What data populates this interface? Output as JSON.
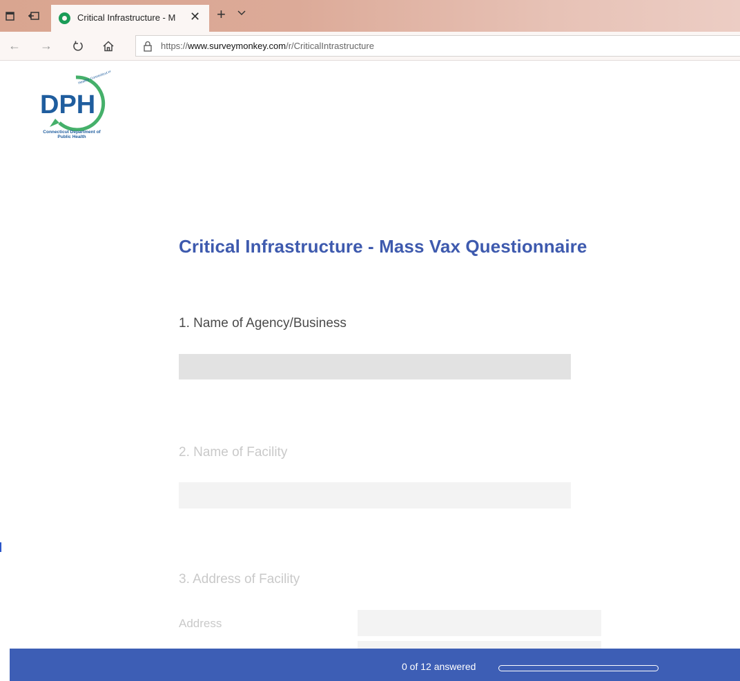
{
  "browser": {
    "tab": {
      "title": "Critical Infrastructure - M",
      "favicon": "surveymonkey-favicon"
    },
    "url": {
      "prefix": "https://",
      "domain": "www.surveymonkey.com",
      "path": "/r/CriticalIntrastructure"
    }
  },
  "logo": {
    "letters": "DPH",
    "arc_text": "Healthy Connecticut Healthy",
    "caption": "Connecticut Department of Public Health"
  },
  "survey": {
    "title": "Critical Infrastructure - Mass Vax Questionnaire",
    "questions": [
      {
        "label": "1. Name of Agency/Business"
      },
      {
        "label": "2. Name of Facility"
      },
      {
        "label": "3. Address of Facility",
        "field_label": "Address"
      }
    ]
  },
  "progress": {
    "answered": 0,
    "total": 12,
    "text": "0 of 12 answered",
    "fraction": 0
  },
  "colors": {
    "accent": "#3e5aae",
    "footer": "#3d5eb5",
    "dph_blue": "#1f5d9e",
    "dph_green": "#45b06a"
  }
}
